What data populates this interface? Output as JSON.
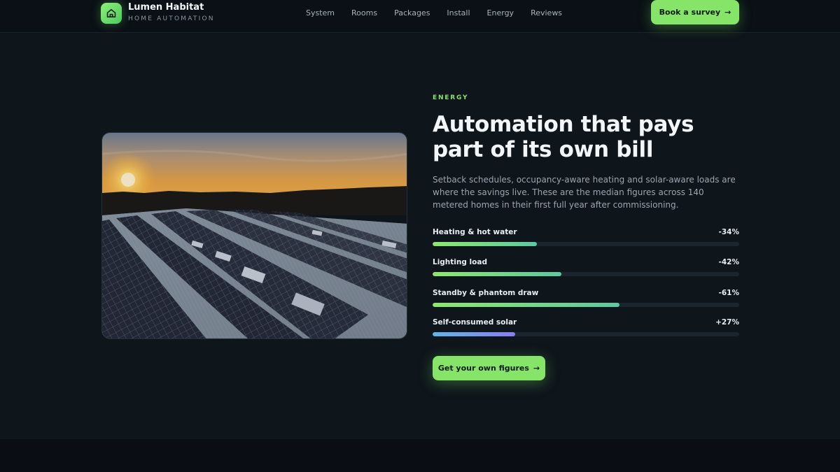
{
  "brand": {
    "name": "Lumen Habitat",
    "tagline": "HOME AUTOMATION",
    "icon": "home-icon"
  },
  "nav": {
    "items": [
      "System",
      "Rooms",
      "Packages",
      "Install",
      "Energy",
      "Reviews"
    ]
  },
  "header_cta": {
    "label": "Book a survey",
    "icon": "arrow-right-icon"
  },
  "hero": {
    "eyebrow": "ENERGY",
    "headline": "Automation that pays part of its own bill",
    "lead": "Setback schedules, occupancy-aware heating and solar-aware loads are where the savings live. These are the median figures across 140 metered homes in their first full year after commissioning.",
    "image": "solar-panel-roof-at-sunset"
  },
  "metrics": [
    {
      "label": "Heating & hot water",
      "value": "-34%",
      "fill_percent": 34,
      "color": "#6fd170"
    },
    {
      "label": "Lighting load",
      "value": "-42%",
      "fill_percent": 42,
      "color": "#6fd170"
    },
    {
      "label": "Standby & phantom draw",
      "value": "-61%",
      "fill_percent": 61,
      "color": "#6fd170"
    },
    {
      "label": "Self-consumed solar",
      "value": "+27%",
      "fill_percent": 27,
      "color": "#7b8cf0"
    }
  ],
  "main_cta": {
    "label": "Get your own figures",
    "icon": "arrow-right-icon"
  },
  "colors": {
    "accent": "#86e468",
    "background": "#0e151b",
    "header": "#0a1015"
  }
}
